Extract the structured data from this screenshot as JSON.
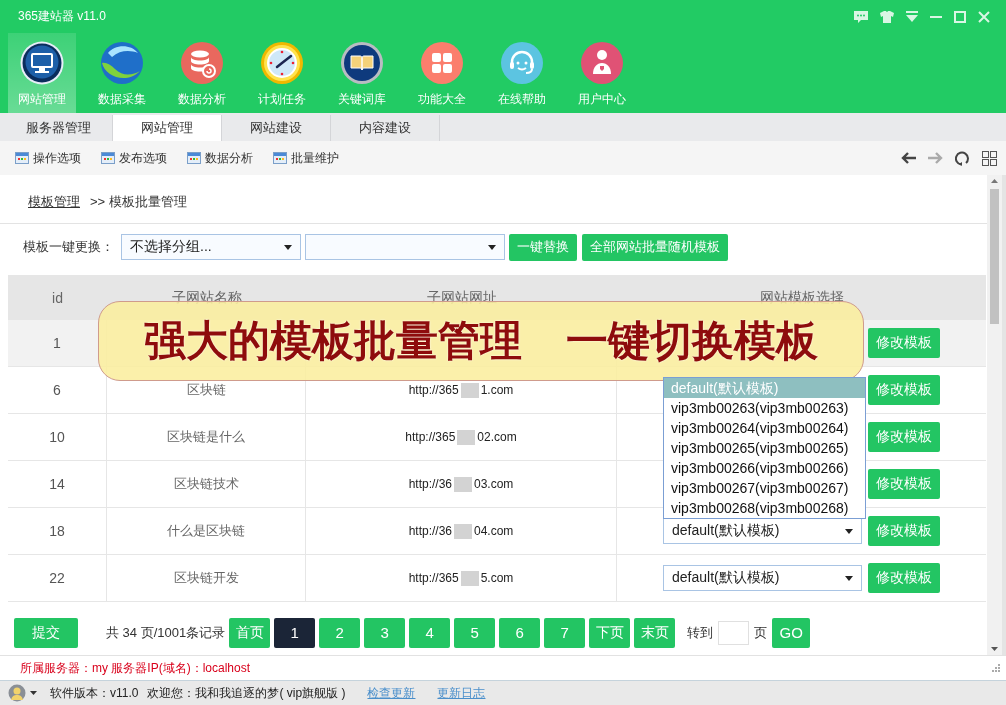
{
  "window": {
    "title": "365建站器 v11.0"
  },
  "nav": [
    {
      "label": "网站管理",
      "selected": true
    },
    {
      "label": "数据采集",
      "selected": false
    },
    {
      "label": "数据分析",
      "selected": false
    },
    {
      "label": "计划任务",
      "selected": false
    },
    {
      "label": "关键词库",
      "selected": false
    },
    {
      "label": "功能大全",
      "selected": false
    },
    {
      "label": "在线帮助",
      "selected": false
    },
    {
      "label": "用户中心",
      "selected": false
    }
  ],
  "tabs": [
    {
      "label": "服务器管理",
      "selected": false
    },
    {
      "label": "网站管理",
      "selected": true
    },
    {
      "label": "网站建设",
      "selected": false
    },
    {
      "label": "内容建设",
      "selected": false
    }
  ],
  "toolbar": {
    "items": [
      "操作选项",
      "发布选项",
      "数据分析",
      "批量维护"
    ]
  },
  "breadcrumb": {
    "link": "模板管理",
    "current": ">> 模板批量管理"
  },
  "bulk_change": {
    "label": "模板一键更换：",
    "group_select": "不选择分组...",
    "buttons": [
      "一键替换",
      "全部网站批量随机模板"
    ]
  },
  "table": {
    "columns": [
      "id",
      "子网站名称",
      "子网站网址",
      "网站模板选择"
    ],
    "rows": [
      {
        "id": "1",
        "highlighted": true,
        "button": "修改模板"
      },
      {
        "id": "6",
        "highlighted": false,
        "name": "区块链",
        "url_start": "http://365",
        "url_end": "1.com",
        "button": "修改模板"
      },
      {
        "id": "10",
        "highlighted": false,
        "name": "区块链是什么",
        "url_start": "http://365",
        "url_end": "02.com",
        "button": "修改模板"
      },
      {
        "id": "14",
        "highlighted": false,
        "name": "区块链技术",
        "url_start": "http://36",
        "url_end": "03.com",
        "button": "修改模板"
      },
      {
        "id": "18",
        "highlighted": false,
        "name": "什么是区块链",
        "url_start": "http://36",
        "url_end": "04.com",
        "template": "default(默认模板)",
        "button": "修改模板"
      },
      {
        "id": "22",
        "highlighted": false,
        "name": "区块链开发",
        "url_start": "http://365",
        "url_end": "5.com",
        "template": "default(默认模板)",
        "button": "修改模板"
      }
    ]
  },
  "template_dropdown": {
    "options": [
      {
        "label": "default(默认模板)",
        "selected": true
      },
      {
        "label": "vip3mb00263(vip3mb00263)",
        "selected": false
      },
      {
        "label": "vip3mb00264(vip3mb00264)",
        "selected": false
      },
      {
        "label": "vip3mb00265(vip3mb00265)",
        "selected": false
      },
      {
        "label": "vip3mb00266(vip3mb00266)",
        "selected": false
      },
      {
        "label": "vip3mb00267(vip3mb00267)",
        "selected": false
      },
      {
        "label": "vip3mb00268(vip3mb00268)",
        "selected": false
      }
    ]
  },
  "banner": "强大的模板批量管理 一键切换模板",
  "pagination": {
    "submit": "提交",
    "summary": "共 34 页/1001条记录",
    "pages": [
      {
        "label": "首页",
        "selected": false
      },
      {
        "label": "1",
        "selected": true
      },
      {
        "label": "2",
        "selected": false
      },
      {
        "label": "3",
        "selected": false
      },
      {
        "label": "4",
        "selected": false
      },
      {
        "label": "5",
        "selected": false
      },
      {
        "label": "6",
        "selected": false
      },
      {
        "label": "7",
        "selected": false
      },
      {
        "label": "下页",
        "selected": false
      },
      {
        "label": "末页",
        "selected": false
      }
    ],
    "goto_label": "转到",
    "page_unit": "页",
    "go": "GO"
  },
  "server_info": "所属服务器：my 服务器IP(域名)：localhost",
  "status_bar": {
    "version": "软件版本：v11.0",
    "welcome": "欢迎您：我和我追逐的梦( vip旗舰版 )",
    "links": [
      "检查更新",
      "更新日志"
    ]
  }
}
